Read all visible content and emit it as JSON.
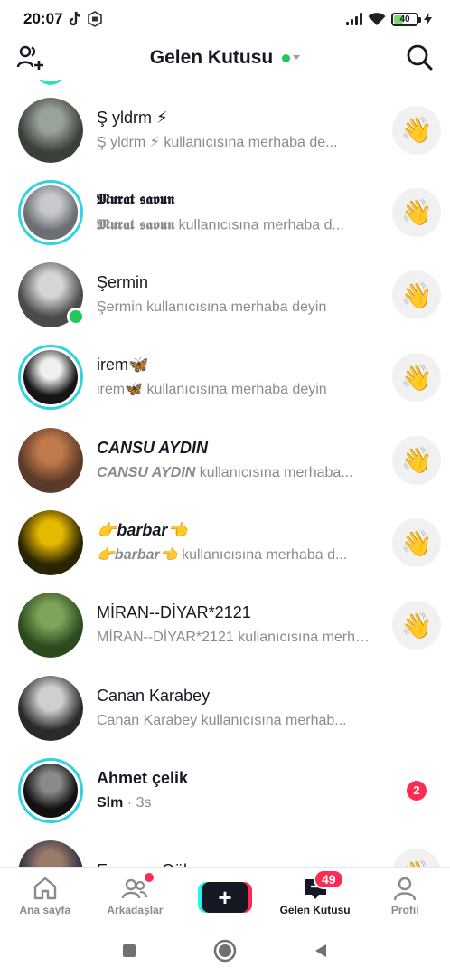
{
  "status_bar": {
    "time": "20:07",
    "battery_level": "40",
    "app_icons": [
      "tiktok-icon",
      "nfc-icon"
    ]
  },
  "header": {
    "title": "Gelen Kutusu",
    "online_color": "#1fc95c"
  },
  "conversations": [
    {
      "name": "Ş yldrm ⚡",
      "preview_name": "Ş yldrm ⚡",
      "preview_suffix": " kullanıcısına merhaba de...",
      "style": "normal",
      "ring": false,
      "online": false,
      "action": "wave",
      "avatar_colors": [
        "#3a3f3a",
        "#9aa39a"
      ]
    },
    {
      "name": "𝕸𝖚𝖗𝖆𝖙 𝖘𝖆𝖛𝖚𝖓",
      "preview_name": "𝕸𝖚𝖗𝖆𝖙 𝖘𝖆𝖛𝖚𝖓",
      "preview_suffix": " kullanıcısına merhaba d...",
      "style": "gothic",
      "ring": true,
      "online": false,
      "action": "wave",
      "avatar_colors": [
        "#6b6f74",
        "#c7c9cc"
      ]
    },
    {
      "name": "Şermin",
      "preview_name": "Şermin",
      "preview_suffix": " kullanıcısına merhaba deyin",
      "style": "normal",
      "ring": false,
      "online": true,
      "action": "wave",
      "avatar_colors": [
        "#4a4a4a",
        "#d8d6d4"
      ]
    },
    {
      "name": "irem🦋",
      "preview_name": "irem🦋",
      "preview_suffix": " kullanıcısına merhaba deyin",
      "style": "normal",
      "ring": true,
      "online": false,
      "action": "wave",
      "avatar_colors": [
        "#151515",
        "#efefef"
      ]
    },
    {
      "name": "CANSU AYDIN",
      "preview_name": "CANSU AYDIN",
      "preview_suffix": " kullanıcısına merhaba...",
      "style": "italic-bold",
      "ring": false,
      "online": false,
      "action": "wave",
      "avatar_colors": [
        "#5a3a28",
        "#c27a4a"
      ]
    },
    {
      "name": "👉barbar👈",
      "preview_name": "👉barbar👈",
      "preview_suffix": " kullanıcısına merhaba d...",
      "style": "italic-bold",
      "ring": false,
      "online": false,
      "action": "wave",
      "avatar_colors": [
        "#2a2405",
        "#e6b800"
      ]
    },
    {
      "name": "MİRAN--DİYAR*2121",
      "preview_name": "MİRAN--DİYAR*2121",
      "preview_suffix": " kullanıcısına merhaba me...",
      "style": "normal",
      "ring": false,
      "online": false,
      "action": "wave",
      "avatar_colors": [
        "#2c4a1e",
        "#7fa35a"
      ]
    },
    {
      "name": "Canan Karabey",
      "preview_name": "Canan Karabey",
      "preview_suffix": " kullanıcısına merhab...",
      "style": "normal",
      "ring": false,
      "online": false,
      "action": "none",
      "avatar_colors": [
        "#2a2a2a",
        "#cfcfcf"
      ]
    },
    {
      "name": "Ahmet çelik",
      "message": "Slm",
      "time": " · 3s",
      "style": "bold",
      "ring": true,
      "online": false,
      "action": "unread",
      "unread_count": "2",
      "avatar_colors": [
        "#111111",
        "#8a8a8a"
      ]
    },
    {
      "name": "Egemen Gül",
      "preview_name": "",
      "preview_suffix": "",
      "style": "normal",
      "ring": false,
      "online": false,
      "action": "wave",
      "avatar_colors": [
        "#2a2c40",
        "#9a7a6a"
      ]
    }
  ],
  "wave_emoji": "👋",
  "bottom_nav": {
    "items": [
      {
        "label": "Ana sayfa",
        "icon": "home-icon"
      },
      {
        "label": "Arkadaşlar",
        "icon": "friends-icon"
      },
      {
        "label": "",
        "icon": "create-plus-icon"
      },
      {
        "label": "Gelen Kutusu",
        "icon": "inbox-icon",
        "badge": "49"
      },
      {
        "label": "Profil",
        "icon": "profile-icon"
      }
    ],
    "plus_glyph": "+"
  },
  "colors": {
    "accent_red": "#fe2c55",
    "ring_cyan": "#2fd4e0",
    "text_primary": "#161823",
    "text_secondary": "#8a8b91"
  }
}
